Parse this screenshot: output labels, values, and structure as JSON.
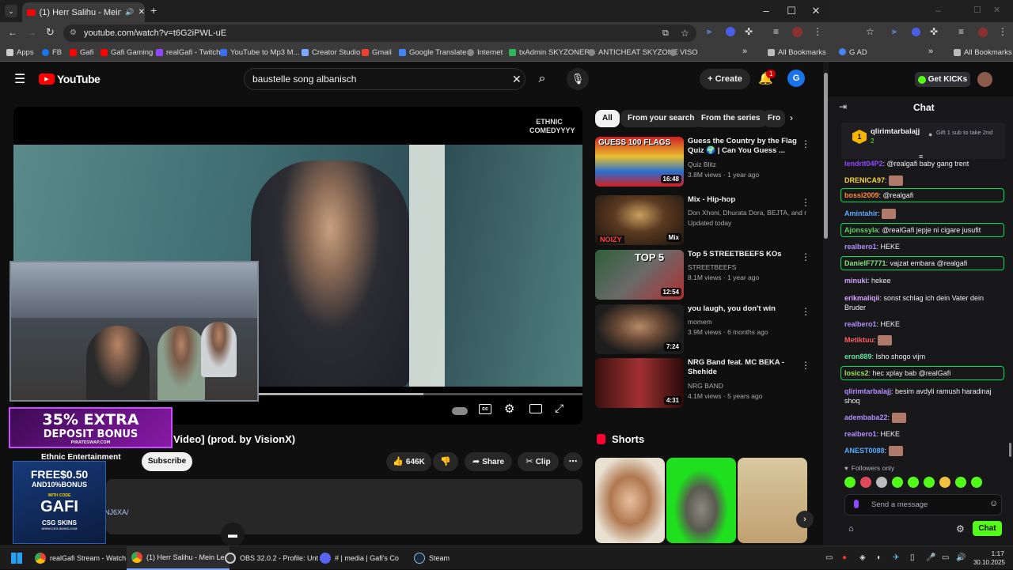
{
  "browser": {
    "tab_title": "(1) Herr Salihu - Mein Lebe",
    "url": "youtube.com/watch?v=t6G2iPWL-uE",
    "bookmarks": [
      "Apps",
      "FB",
      "Gafi",
      "Gafi Gaming",
      "realGafi - Twitch",
      "YouTube to Mp3 M...",
      "Creator Studio",
      "Gmail",
      "Google Translate",
      "Internet",
      "txAdmin SKYZONERP",
      "ANTICHEAT SKYZONE",
      "VISO"
    ],
    "all_bookmarks": "All Bookmarks"
  },
  "youtube": {
    "logo": "YouTube",
    "search_value": "baustelle song albanisch",
    "create_label": "Create",
    "notif_count": "1",
    "avatar_letter": "G",
    "video_watermark": "ETHNIC COMEDYYYY",
    "video_title_fragment": "Video] (prod. by VisionX)",
    "channel_name": "Ethnic Entertainment",
    "subscribe": "Subscribe",
    "likes": "646K",
    "share": "Share",
    "clip": "Clip",
    "desc_fragment": "NJ6XA/",
    "filters": [
      "All",
      "From your search",
      "From the series",
      "Fro"
    ],
    "recommendations": [
      {
        "title": "Guess the Country by the Flag Quiz 🌍 | Can You Guess ...",
        "channel": "Quiz Blitz",
        "stats": "3.8M views · 1 year ago",
        "duration": "16:48",
        "thumb_text": "GUESS 100 FLAGS"
      },
      {
        "title": "Mix - Hip-hop",
        "channel": "Don Xhoni, Dhurata Dora, BEJTA, and mo...",
        "stats": "Updated today",
        "duration": "Mix",
        "thumb_text": "NOIZY"
      },
      {
        "title": "Top 5 STREETBEEFS KOs",
        "channel": "STREETBEEFS",
        "stats": "8.1M views · 1 year ago",
        "duration": "12:54",
        "thumb_text": "TOP 5"
      },
      {
        "title": "you laugh, you don't win",
        "channel": "momem",
        "stats": "3.9M views · 6 months ago",
        "duration": "7:24",
        "thumb_text": ""
      },
      {
        "title": "NRG Band feat. MC BEKA - Shehide",
        "channel": "NRG BAND",
        "stats": "4.1M views · 5 years ago",
        "duration": "4:31",
        "thumb_text": ""
      }
    ],
    "shorts_label": "Shorts"
  },
  "overlay": {
    "ad1_line1": "35% EXTRA",
    "ad1_line2": "DEPOSIT BONUS",
    "ad1_site": "PIRATESWAP.COM",
    "ad2_line1": "FREE$0.50",
    "ad2_line2": "AND10%BONUS",
    "ad2_code_label": "WITH CODE",
    "ad2_code": "GAFI",
    "ad2_brand": "CSG SKINS",
    "ad2_site": "WWW.CSG-SKINS.COM"
  },
  "chat": {
    "get_kicks": "Get KICKs",
    "title": "Chat",
    "pinned_user": "qlirimtarbalajj",
    "pinned_badge": "1",
    "gift_text": "Gift 1 sub to take 2nd",
    "messages": [
      {
        "user": "lendrit04P2",
        "text": "@realgafi baby gang trent",
        "color": "#9147ff",
        "hl": false
      },
      {
        "user": "DRENICA97",
        "text": "",
        "color": "#f5d33a",
        "hl": false
      },
      {
        "user": "bossi2009",
        "text": "@realgafi",
        "color": "#ff8c3a",
        "hl": true
      },
      {
        "user": "Amintahir",
        "text": "",
        "color": "#5aa9ff",
        "hl": false
      },
      {
        "user": "Ajonssyla",
        "text": "@realGafi jepje ni cigare jusufit",
        "color": "#5fd35f",
        "hl": true
      },
      {
        "user": "realbero1",
        "text": "HEKE",
        "color": "#b28dff",
        "hl": false
      },
      {
        "user": "DanielF7771",
        "text": "vajzat embara @realgafi",
        "color": "#7fe37f",
        "hl": true
      },
      {
        "user": "minuki",
        "text": "hekee",
        "color": "#cfa3ff",
        "hl": false
      },
      {
        "user": "erikmaliqii",
        "text": "sonst schlag ich dein Vater dein Bruder",
        "color": "#d8a2ff",
        "hl": false
      },
      {
        "user": "realbero1",
        "text": "HEKE",
        "color": "#b28dff",
        "hl": false
      },
      {
        "user": "Metiktuu",
        "text": "",
        "color": "#ff5a5a",
        "hl": false
      },
      {
        "user": "eron889",
        "text": "Isho shogo vijm",
        "color": "#5fe3a0",
        "hl": false
      },
      {
        "user": "losics2",
        "text": "hec xplay bab @realGafi",
        "color": "#9fe35a",
        "hl": true
      },
      {
        "user": "qlirimtarbalajj",
        "text": "besim avdyli ramush haradinaj shoq",
        "color": "#b28dff",
        "hl": false
      },
      {
        "user": "adembaba22",
        "text": "",
        "color": "#b28dff",
        "hl": false
      },
      {
        "user": "realbero1",
        "text": "HEKE",
        "color": "#b28dff",
        "hl": false
      },
      {
        "user": "ANEST0088",
        "text": "",
        "color": "#5aa9ff",
        "hl": false
      }
    ],
    "followers_only": "Followers only",
    "send_placeholder": "Send a message",
    "chat_button": "Chat",
    "right_tab": "G AD"
  },
  "taskbar": {
    "items": [
      "realGafi Stream - Watch",
      "(1) Herr Salihu - Mein Le",
      "OBS 32.0.2 - Profile: Unt",
      "# | media | Gafi's Co",
      "Steam"
    ],
    "time": "1:17",
    "date": "30.10.2025"
  }
}
